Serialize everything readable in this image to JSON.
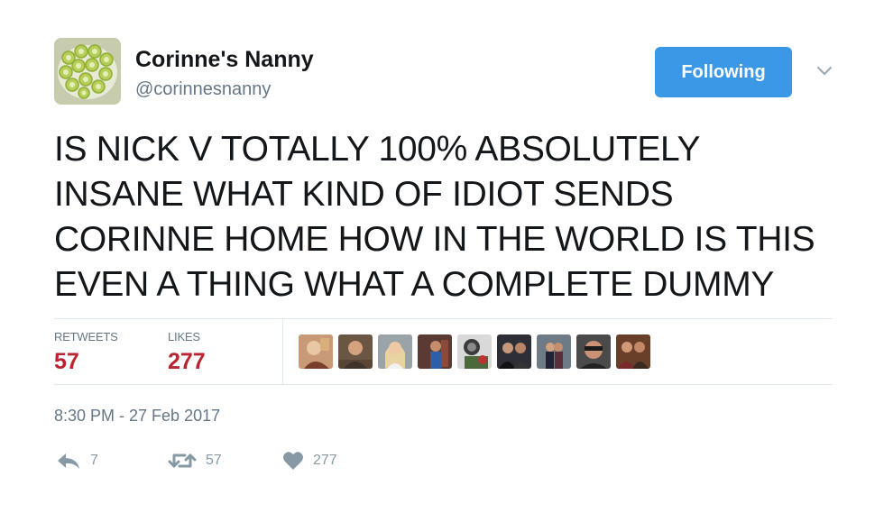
{
  "user": {
    "display_name": "Corinne's Nanny",
    "handle": "@corinnesnanny",
    "avatar_icon": "cucumber-slices-photo"
  },
  "follow_button": {
    "label": "Following",
    "color": "#3a98e6"
  },
  "menu": {
    "icon": "chevron-down-icon"
  },
  "tweet": {
    "text": "IS NICK V TOTALLY 100% ABSOLUTELY INSANE WHAT KIND OF IDIOT SENDS CORINNE HOME HOW IN THE WORLD IS THIS EVEN A THING WHAT A COMPLETE DUMMY",
    "lines": [
      "IS NICK V TOTALLY 100% ABSOLUTELY",
      "INSANE WHAT KIND OF IDIOT SENDS",
      "CORINNE HOME HOW IN THE WORLD IS THIS",
      "EVEN A THING WHAT A COMPLETE DUMMY"
    ]
  },
  "stats": {
    "retweets_label": "RETWEETS",
    "retweets_count": "57",
    "likes_label": "LIKES",
    "likes_count": "277",
    "count_color": "#b8242f"
  },
  "likers": [
    {
      "name": "liker-avatar-1"
    },
    {
      "name": "liker-avatar-2"
    },
    {
      "name": "liker-avatar-3"
    },
    {
      "name": "liker-avatar-4"
    },
    {
      "name": "liker-avatar-5"
    },
    {
      "name": "liker-avatar-6"
    },
    {
      "name": "liker-avatar-7"
    },
    {
      "name": "liker-avatar-8"
    },
    {
      "name": "liker-avatar-9"
    }
  ],
  "timestamp": "8:30 PM - 27 Feb 2017",
  "actions": {
    "reply": {
      "icon": "reply-icon",
      "count": "7"
    },
    "retweet": {
      "icon": "retweet-icon",
      "count": "57"
    },
    "like": {
      "icon": "heart-icon",
      "count": "277"
    }
  }
}
